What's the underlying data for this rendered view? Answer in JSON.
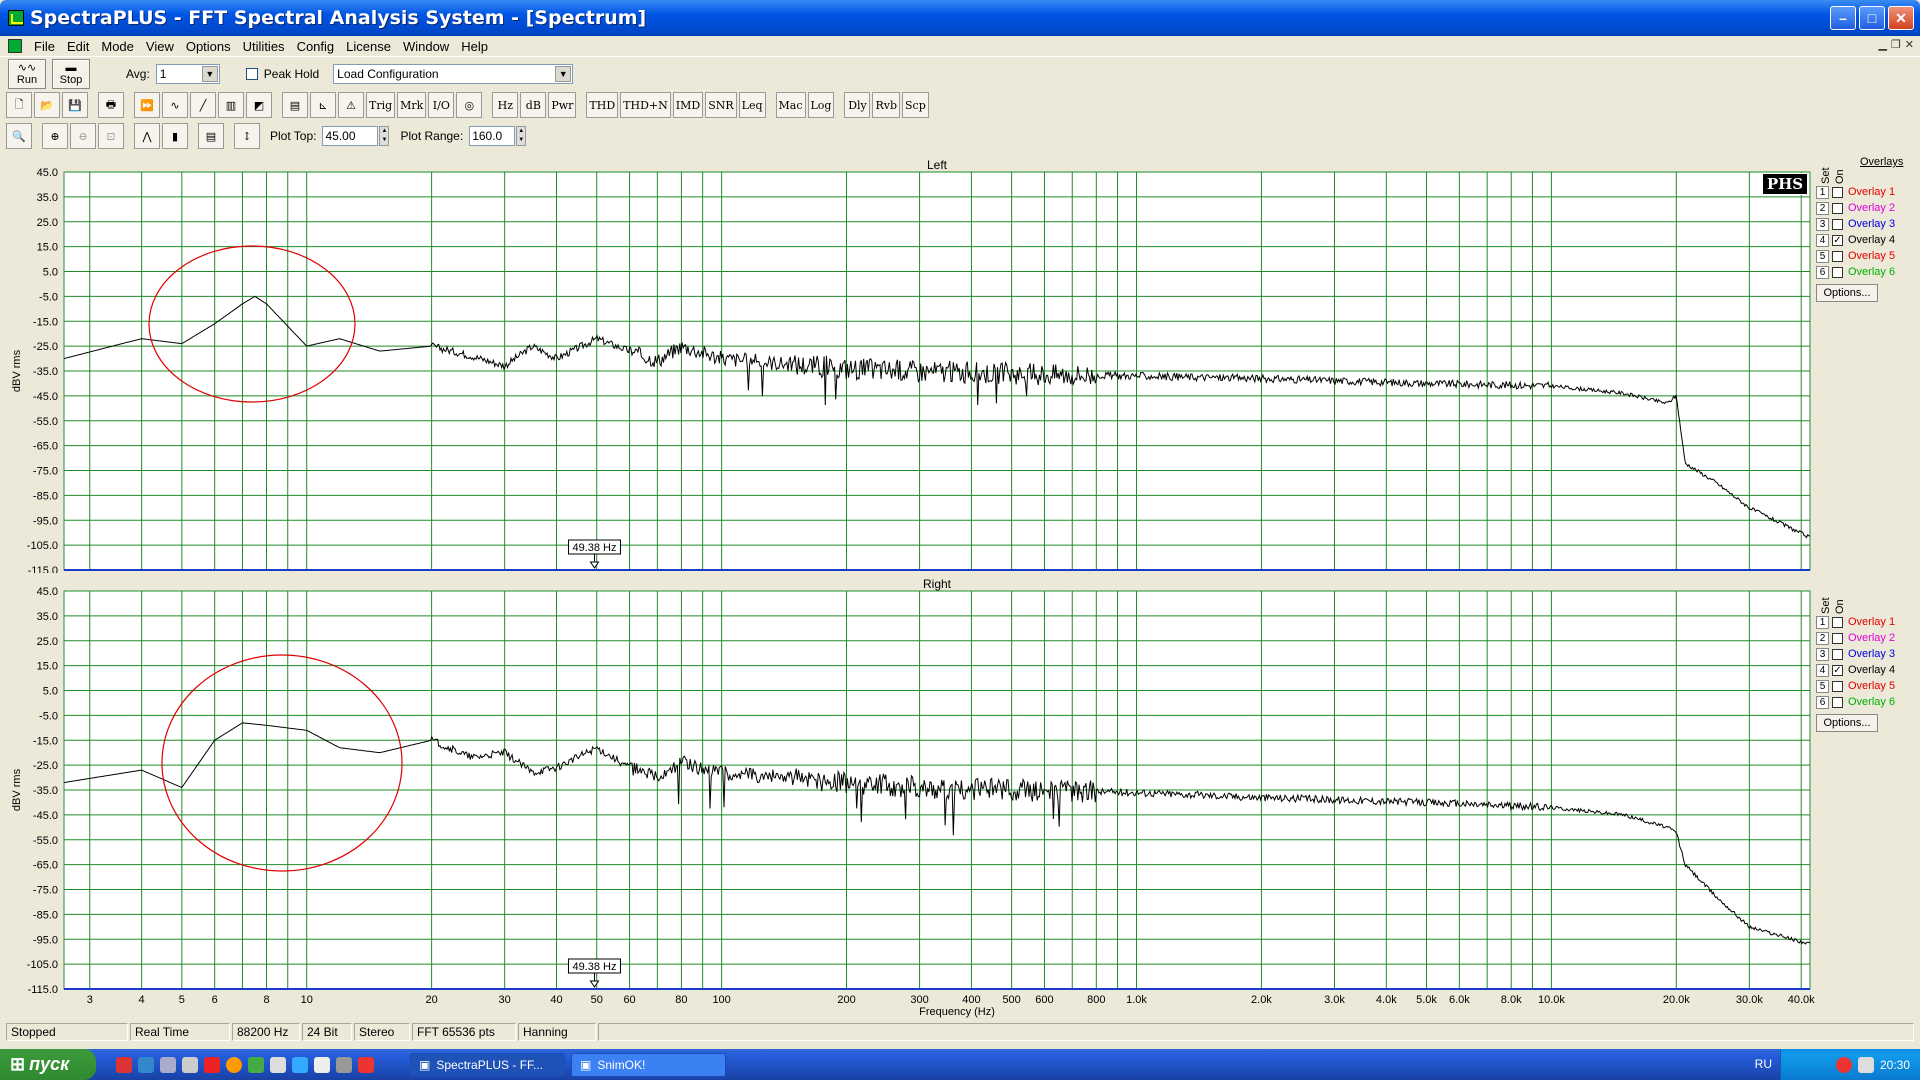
{
  "window": {
    "title": "SpectraPLUS - FFT Spectral Analysis System - [Spectrum]"
  },
  "menu": [
    "File",
    "Edit",
    "Mode",
    "View",
    "Options",
    "Utilities",
    "Config",
    "License",
    "Window",
    "Help"
  ],
  "toolbar1": {
    "run_label": "Run",
    "stop_label": "Stop",
    "avg_label": "Avg:",
    "avg_value": "1",
    "peak_hold_label": "Peak Hold",
    "config_value": "Load Configuration"
  },
  "toolbar2": [
    "Trig",
    "Mrk",
    "I/O",
    "Hz",
    "dB",
    "Pwr",
    "THD",
    "THD+N",
    "IMD",
    "SNR",
    "Leq",
    "Mac",
    "Log",
    "Dly",
    "Rvb",
    "Scp"
  ],
  "toolbar3": {
    "plot_top_label": "Plot Top:",
    "plot_top_value": "45.00",
    "plot_range_label": "Plot Range:",
    "plot_range_value": "160.0"
  },
  "overlays": {
    "header": "Overlays",
    "set_label": "Set",
    "on_label": "On",
    "options_label": "Options...",
    "logo": "PHS",
    "items": [
      {
        "num": "1",
        "label": "Overlay 1",
        "color": "#e00000",
        "checked": false
      },
      {
        "num": "2",
        "label": "Overlay 2",
        "color": "#e000e0",
        "checked": false
      },
      {
        "num": "3",
        "label": "Overlay 3",
        "color": "#0000e0",
        "checked": false
      },
      {
        "num": "4",
        "label": "Overlay 4",
        "color": "#000000",
        "checked": true
      },
      {
        "num": "5",
        "label": "Overlay 5",
        "color": "#e00000",
        "checked": false
      },
      {
        "num": "6",
        "label": "Overlay 6",
        "color": "#00b000",
        "checked": false
      }
    ]
  },
  "chart_data": [
    {
      "type": "line",
      "title": "Left",
      "xlabel": "Frequency (Hz)",
      "ylabel": "dBV rms",
      "xscale": "log",
      "xlim": [
        2.6,
        42000
      ],
      "ylim": [
        -115,
        45
      ],
      "yticks": [
        "45.0",
        "35.0",
        "25.0",
        "15.0",
        "5.0",
        "-5.0",
        "-15.0",
        "-25.0",
        "-35.0",
        "-45.0",
        "-55.0",
        "-65.0",
        "-75.0",
        "-85.0",
        "-95.0",
        "-105.0",
        "-115.0"
      ],
      "cursor_label": "49.38 Hz",
      "annotation": "red ellipse around 4-25 Hz bump",
      "series": [
        {
          "x": [
            2.6,
            4,
            5,
            6,
            7,
            7.5,
            8,
            9,
            10,
            12,
            15,
            20,
            25,
            30,
            35,
            40,
            50,
            60,
            70,
            80,
            100,
            200,
            300,
            500,
            1000,
            2000,
            5000,
            10000,
            15000,
            19000,
            20000,
            21000,
            25000,
            30000,
            42000
          ],
          "y": [
            -30,
            -22,
            -24,
            -16,
            -8,
            -5,
            -8,
            -17,
            -25,
            -22,
            -27,
            -25,
            -29,
            -33,
            -25,
            -30,
            -22,
            -27,
            -31,
            -25,
            -30,
            -34,
            -35,
            -36,
            -37,
            -38,
            -40,
            -41,
            -44,
            -48,
            -45,
            -72,
            -80,
            -90,
            -102
          ]
        }
      ]
    },
    {
      "type": "line",
      "title": "Right",
      "xlabel": "Frequency (Hz)",
      "ylabel": "dBV rms",
      "xscale": "log",
      "xlim": [
        2.6,
        42000
      ],
      "ylim": [
        -115,
        45
      ],
      "yticks": [
        "45.0",
        "35.0",
        "25.0",
        "15.0",
        "5.0",
        "-5.0",
        "-15.0",
        "-25.0",
        "-35.0",
        "-45.0",
        "-55.0",
        "-65.0",
        "-75.0",
        "-85.0",
        "-95.0",
        "-105.0",
        "-115.0"
      ],
      "xticks": [
        "3",
        "4",
        "5",
        "6",
        "8",
        "10",
        "20",
        "30",
        "40",
        "50",
        "60",
        "80",
        "100",
        "200",
        "300",
        "400",
        "500",
        "600",
        "800",
        "1.0k",
        "2.0k",
        "3.0k",
        "4.0k",
        "5.0k",
        "6.0k",
        "8.0k",
        "10.0k",
        "20.0k",
        "30.0k",
        "40.0k"
      ],
      "cursor_label": "49.38 Hz",
      "annotation": "red ellipse around 4-25 Hz bump",
      "series": [
        {
          "x": [
            2.6,
            4,
            5,
            6,
            7,
            8,
            10,
            12,
            15,
            20,
            25,
            30,
            35,
            40,
            50,
            60,
            70,
            80,
            100,
            200,
            300,
            500,
            1000,
            2000,
            5000,
            10000,
            15000,
            19000,
            20000,
            21000,
            25000,
            30000,
            42000
          ],
          "y": [
            -32,
            -27,
            -34,
            -15,
            -8,
            -9,
            -11,
            -18,
            -20,
            -15,
            -22,
            -20,
            -28,
            -26,
            -18,
            -26,
            -30,
            -24,
            -28,
            -32,
            -34,
            -35,
            -36,
            -38,
            -40,
            -42,
            -45,
            -50,
            -52,
            -65,
            -78,
            -90,
            -97
          ]
        }
      ]
    }
  ],
  "status": [
    "Stopped",
    "Real Time",
    "88200 Hz",
    "24 Bit",
    "Stereo",
    "FFT 65536 pts",
    "Hanning"
  ],
  "taskbar": {
    "start_label": "пуск",
    "tasks": [
      "SpectraPLUS - FF...",
      "SnimOK!"
    ],
    "lang": "RU",
    "clock": "20:30"
  }
}
